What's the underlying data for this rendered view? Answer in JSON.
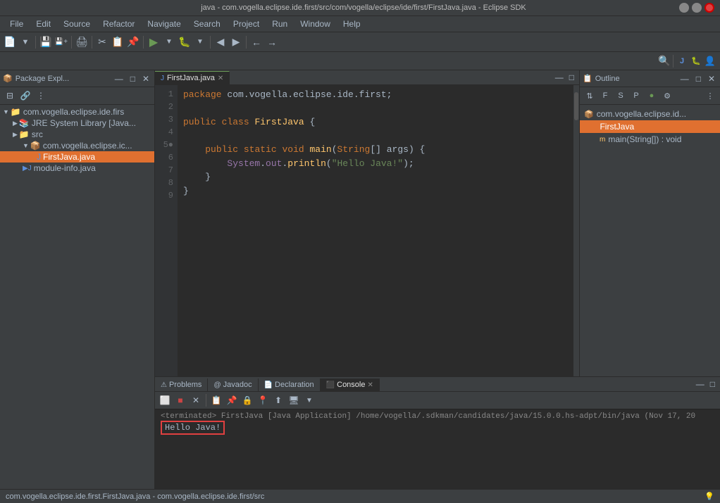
{
  "titleBar": {
    "title": "java - com.vogella.eclipse.ide.first/src/com/vogella/eclipse/ide/first/FirstJava.java - Eclipse SDK"
  },
  "menuBar": {
    "items": [
      "File",
      "Edit",
      "Source",
      "Refactor",
      "Navigate",
      "Search",
      "Project",
      "Run",
      "Window",
      "Help"
    ]
  },
  "packageExplorer": {
    "title": "Package Expl...",
    "tree": [
      {
        "label": "com.vogella.eclipse.ide.firs",
        "indent": 0,
        "type": "project",
        "arrow": "▼"
      },
      {
        "label": "JRE System Library [Java...",
        "indent": 1,
        "type": "lib",
        "arrow": "▶"
      },
      {
        "label": "src",
        "indent": 1,
        "type": "folder",
        "arrow": "▶"
      },
      {
        "label": "com.vogella.eclipse.ic...",
        "indent": 2,
        "type": "package",
        "arrow": "▼"
      },
      {
        "label": "FirstJava.java",
        "indent": 3,
        "type": "java",
        "arrow": "",
        "selected": true
      },
      {
        "label": "module-info.java",
        "indent": 2,
        "type": "java",
        "arrow": ""
      }
    ]
  },
  "editor": {
    "tab": "FirstJava.java",
    "lines": [
      {
        "num": 1,
        "code": "package com.vogella.eclipse.ide.first;"
      },
      {
        "num": 2,
        "code": ""
      },
      {
        "num": 3,
        "code": "public class FirstJava {"
      },
      {
        "num": 4,
        "code": ""
      },
      {
        "num": 5,
        "code": "    public static void main(String[] args) {"
      },
      {
        "num": 6,
        "code": "        System.out.println(\"Hello Java!\");"
      },
      {
        "num": 7,
        "code": "    }"
      },
      {
        "num": 8,
        "code": "}"
      },
      {
        "num": 9,
        "code": ""
      }
    ]
  },
  "outline": {
    "title": "Outline",
    "items": [
      {
        "label": "com.vogella.eclipse.id...",
        "indent": 0,
        "type": "package"
      },
      {
        "label": "FirstJava",
        "indent": 1,
        "type": "class",
        "selected": true
      },
      {
        "label": "main(String[]) : void",
        "indent": 2,
        "type": "method"
      }
    ]
  },
  "bottomTabs": {
    "tabs": [
      "Problems",
      "Javadoc",
      "Declaration",
      "Console"
    ],
    "activeTab": "Console"
  },
  "console": {
    "terminated": "<terminated> FirstJava [Java Application] /home/vogella/.sdkman/candidates/java/15.0.0.hs-adpt/bin/java  (Nov 17, 20",
    "output": "Hello Java!"
  },
  "statusBar": {
    "left": "com.vogella.eclipse.ide.first.FirstJava.java - com.vogella.eclipse.ide.first/src",
    "right": ""
  }
}
